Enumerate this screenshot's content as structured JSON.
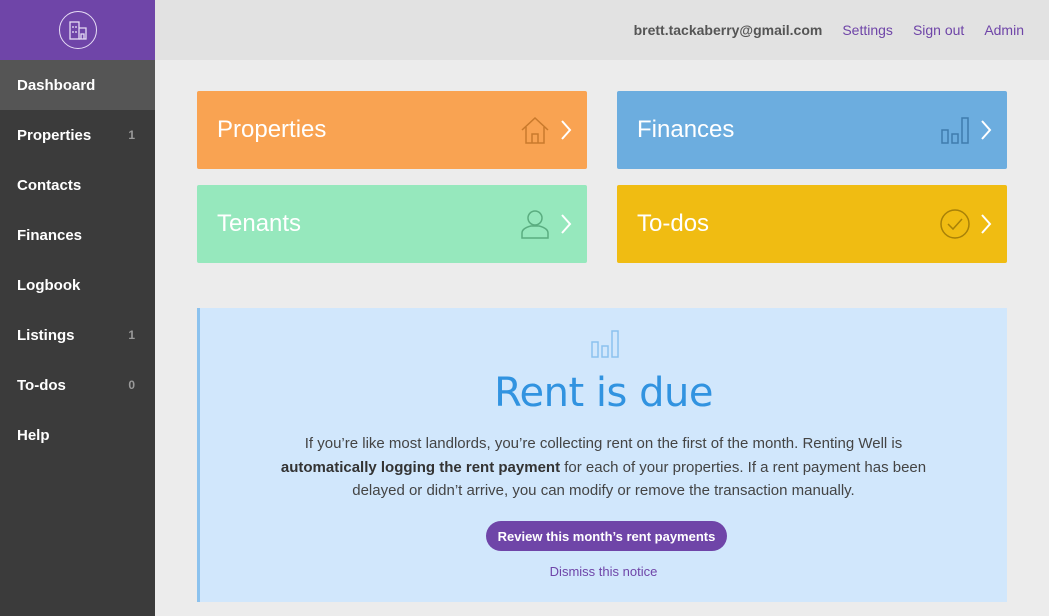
{
  "sidebar": {
    "logo_icon": "building-icon",
    "items": [
      {
        "label": "Dashboard",
        "count": ""
      },
      {
        "label": "Properties",
        "count": "1"
      },
      {
        "label": "Contacts",
        "count": ""
      },
      {
        "label": "Finances",
        "count": ""
      },
      {
        "label": "Logbook",
        "count": ""
      },
      {
        "label": "Listings",
        "count": "1"
      },
      {
        "label": "To-dos",
        "count": "0"
      },
      {
        "label": "Help",
        "count": ""
      }
    ],
    "active": "Dashboard"
  },
  "topbar": {
    "email": "brett.tackaberry@gmail.com",
    "settings": "Settings",
    "sign_out": "Sign out",
    "admin": "Admin"
  },
  "tiles": {
    "properties": {
      "label": "Properties",
      "icon": "house-icon",
      "color": "#f9a352"
    },
    "finances": {
      "label": "Finances",
      "icon": "bar-chart-icon",
      "color": "#6caddf"
    },
    "tenants": {
      "label": "Tenants",
      "icon": "person-icon",
      "color": "#96e8bd"
    },
    "todos": {
      "label": "To-dos",
      "icon": "check-circle-icon",
      "color": "#f0bc12"
    }
  },
  "notice": {
    "icon": "bar-chart-icon",
    "title": "Rent is due",
    "body_pre": "If you’re like most landlords, you’re collecting rent on the first of the month. Renting Well is ",
    "body_bold": "automatically logging the rent payment",
    "body_post": " for each of your properties. If a rent payment has been delayed or didn’t arrive, you can modify or remove the transaction manually.",
    "button": "Review this month’s rent payments",
    "dismiss": "Dismiss this notice"
  },
  "colors": {
    "accent": "#6f45a8",
    "sidebar_bg": "#3b3b3b",
    "notice_bg": "#d1e7fc",
    "notice_title": "#3193e0"
  }
}
